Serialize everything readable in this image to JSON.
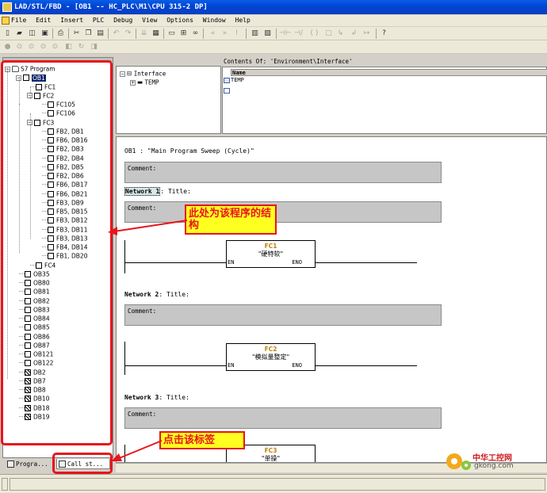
{
  "window": {
    "title": "LAD/STL/FBD  - [OB1 -- HC_PLC\\M1\\CPU 315-2 DP]"
  },
  "menu": [
    "File",
    "Edit",
    "Insert",
    "PLC",
    "Debug",
    "View",
    "Options",
    "Window",
    "Help"
  ],
  "tree": {
    "root": "S7 Program",
    "items": [
      {
        "label": "OB1",
        "level": 1,
        "exp": "-",
        "sel": true
      },
      {
        "label": "FC1",
        "level": 2
      },
      {
        "label": "FC2",
        "level": 2,
        "exp": "-"
      },
      {
        "label": "FC105",
        "level": 3
      },
      {
        "label": "FC106",
        "level": 3
      },
      {
        "label": "FC3",
        "level": 2,
        "exp": "-"
      },
      {
        "label": "FB2, DB1",
        "level": 3
      },
      {
        "label": "FB6, DB16",
        "level": 3
      },
      {
        "label": "FB2, DB3",
        "level": 3
      },
      {
        "label": "FB2, DB4",
        "level": 3
      },
      {
        "label": "FB2, DB5",
        "level": 3
      },
      {
        "label": "FB2, DB6",
        "level": 3
      },
      {
        "label": "FB6, DB17",
        "level": 3
      },
      {
        "label": "FB6, DB21",
        "level": 3
      },
      {
        "label": "FB3, DB9",
        "level": 3
      },
      {
        "label": "FB5, DB15",
        "level": 3
      },
      {
        "label": "FB3, DB12",
        "level": 3
      },
      {
        "label": "FB3, DB11",
        "level": 3
      },
      {
        "label": "FB3, DB13",
        "level": 3
      },
      {
        "label": "FB4, DB14",
        "level": 3
      },
      {
        "label": "FB1, DB20",
        "level": 3
      },
      {
        "label": "FC4",
        "level": 2
      },
      {
        "label": "OB35",
        "level": 1
      },
      {
        "label": "OB80",
        "level": 1
      },
      {
        "label": "OB81",
        "level": 1
      },
      {
        "label": "OB82",
        "level": 1
      },
      {
        "label": "OB83",
        "level": 1
      },
      {
        "label": "OB84",
        "level": 1
      },
      {
        "label": "OB85",
        "level": 1
      },
      {
        "label": "OB86",
        "level": 1
      },
      {
        "label": "OB87",
        "level": 1
      },
      {
        "label": "OB121",
        "level": 1
      },
      {
        "label": "OB122",
        "level": 1
      },
      {
        "label": "DB2",
        "level": 1,
        "db": true
      },
      {
        "label": "DB7",
        "level": 1,
        "db": true
      },
      {
        "label": "DB8",
        "level": 1,
        "db": true
      },
      {
        "label": "DB10",
        "level": 1,
        "db": true
      },
      {
        "label": "DB18",
        "level": 1,
        "db": true
      },
      {
        "label": "DB19",
        "level": 1,
        "db": true
      }
    ]
  },
  "tabs": {
    "program": "Progra...",
    "callstructure": "Call st..."
  },
  "interface": {
    "root": "Interface",
    "child": "TEMP",
    "contents_title": "Contents Of: 'Environment\\Interface'",
    "col_name": "Name",
    "rows": [
      "TEMP"
    ]
  },
  "editor": {
    "block_title": "OB1 :  \"Main Program Sweep (Cycle)\"",
    "comment_label": "Comment:",
    "networks": [
      {
        "label": "Network 1",
        "title": ": Title:",
        "fc": "FC1",
        "desc": "\"硬特软\""
      },
      {
        "label": "Network 2",
        "title": ": Title:",
        "fc": "FC2",
        "desc": "\"模拟量整定\""
      },
      {
        "label": "Network 3",
        "title": ": Title:",
        "fc": "FC3",
        "desc": "\"单操\""
      }
    ],
    "pin_en": "EN",
    "pin_eno": "ENO"
  },
  "annotations": {
    "structure": "此处为该程序的结构",
    "click_tab": "点击该标签"
  },
  "watermark": {
    "name": "中华工控网",
    "url": "gkong.com"
  },
  "colors": {
    "title_blue": "#0046d5",
    "annotation_red": "#e8141c",
    "annotation_yellow": "#ffff20",
    "fc_gold": "#b8860b"
  }
}
